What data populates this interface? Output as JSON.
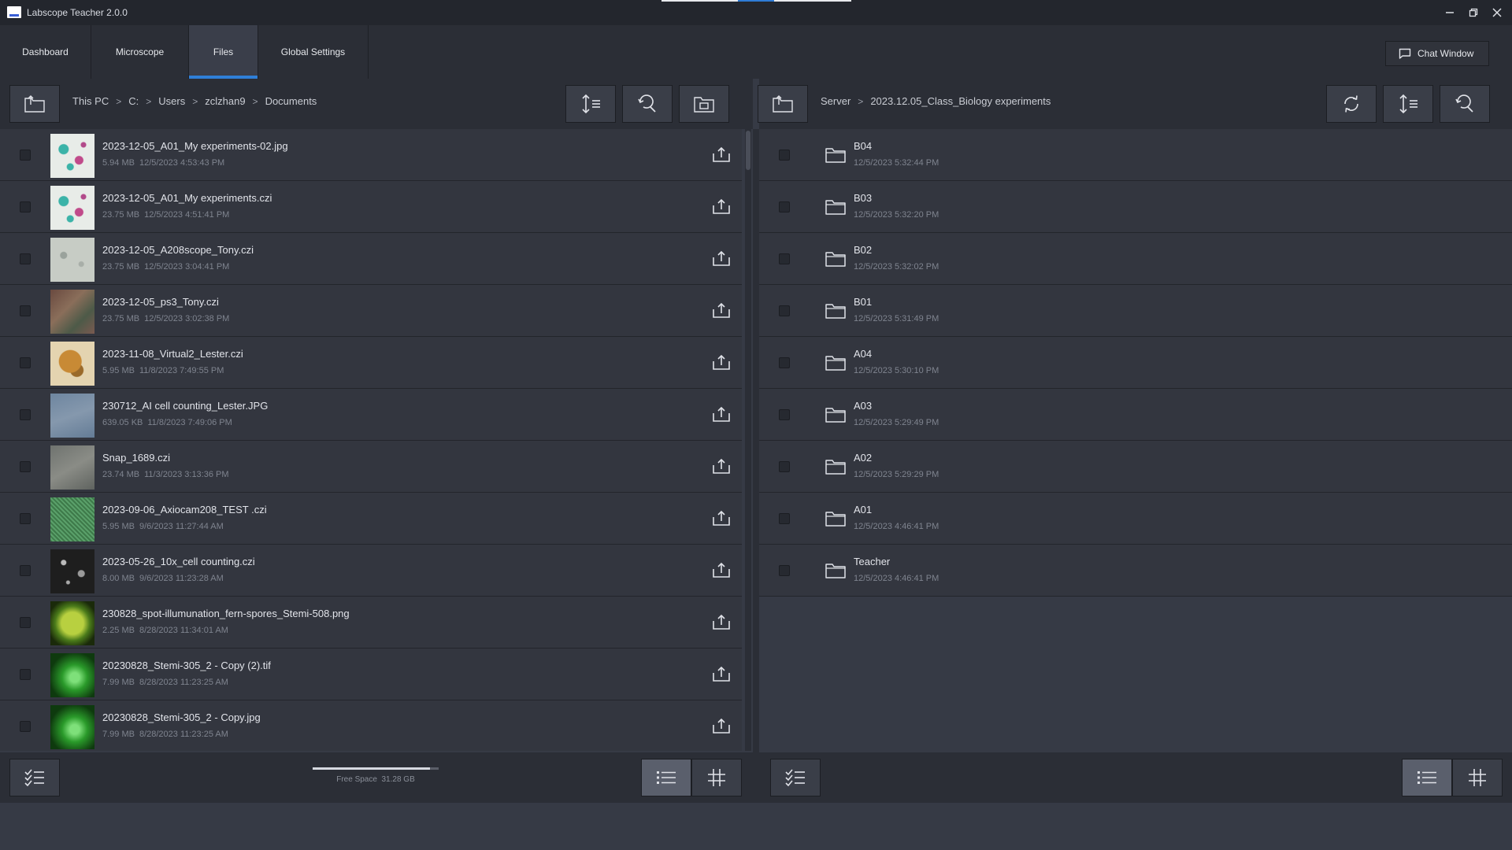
{
  "app": {
    "title": "Labscope Teacher 2.0.0"
  },
  "tabs": [
    {
      "label": "Dashboard",
      "active": false
    },
    {
      "label": "Microscope",
      "active": false
    },
    {
      "label": "Files",
      "active": true
    },
    {
      "label": "Global Settings",
      "active": false
    }
  ],
  "chat_button": {
    "label": "Chat Window"
  },
  "left_panel": {
    "breadcrumb": [
      "This PC",
      "C:",
      "Users",
      "zclzhan9",
      "Documents"
    ],
    "files": [
      {
        "name": "2023-12-05_A01_My experiments-02.jpg",
        "size": "5.94 MB",
        "date": "12/5/2023 4:53:43 PM",
        "thumb": "cells"
      },
      {
        "name": "2023-12-05_A01_My experiments.czi",
        "size": "23.75 MB",
        "date": "12/5/2023 4:51:41 PM",
        "thumb": "cells"
      },
      {
        "name": "2023-12-05_A208scope_Tony.czi",
        "size": "23.75 MB",
        "date": "12/5/2023 3:04:41 PM",
        "thumb": "grey-cells"
      },
      {
        "name": "2023-12-05_ps3_Tony.czi",
        "size": "23.75 MB",
        "date": "12/5/2023 3:02:38 PM",
        "thumb": "tissue"
      },
      {
        "name": "2023-11-08_Virtual2_Lester.czi",
        "size": "5.95 MB",
        "date": "11/8/2023 7:49:55 PM",
        "thumb": "insect"
      },
      {
        "name": "230712_AI cell counting_Lester.JPG",
        "size": "639.05 KB",
        "date": "11/8/2023 7:49:06 PM",
        "thumb": "blue-grey"
      },
      {
        "name": "Snap_1689.czi",
        "size": "23.74 MB",
        "date": "11/3/2023 3:13:36 PM",
        "thumb": "grey"
      },
      {
        "name": "2023-09-06_Axiocam208_TEST .czi",
        "size": "5.95 MB",
        "date": "9/6/2023 11:27:44 AM",
        "thumb": "green-texture"
      },
      {
        "name": "2023-05-26_10x_cell counting.czi",
        "size": "8.00 MB",
        "date": "9/6/2023 11:23:28 AM",
        "thumb": "dark-cells"
      },
      {
        "name": "230828_spot-illumunation_fern-spores_Stemi-508.png",
        "size": "2.25 MB",
        "date": "8/28/2023 11:34:01 AM",
        "thumb": "fern"
      },
      {
        "name": "20230828_Stemi-305_2 - Copy (2).tif",
        "size": "7.99 MB",
        "date": "8/28/2023 11:23:25 AM",
        "thumb": "green-plant"
      },
      {
        "name": "20230828_Stemi-305_2 - Copy.jpg",
        "size": "7.99 MB",
        "date": "8/28/2023 11:23:25 AM",
        "thumb": "green-plant"
      }
    ],
    "free_space": {
      "label": "Free Space",
      "value": "31.28 GB",
      "fill_fraction": 0.93
    }
  },
  "right_panel": {
    "breadcrumb": [
      "Server",
      "2023.12.05_Class_Biology experiments"
    ],
    "folders": [
      {
        "name": "B04",
        "date": "12/5/2023 5:32:44 PM"
      },
      {
        "name": "B03",
        "date": "12/5/2023 5:32:20 PM"
      },
      {
        "name": "B02",
        "date": "12/5/2023 5:32:02 PM"
      },
      {
        "name": "B01",
        "date": "12/5/2023 5:31:49 PM"
      },
      {
        "name": "A04",
        "date": "12/5/2023 5:30:10 PM"
      },
      {
        "name": "A03",
        "date": "12/5/2023 5:29:49 PM"
      },
      {
        "name": "A02",
        "date": "12/5/2023 5:29:29 PM"
      },
      {
        "name": "A01",
        "date": "12/5/2023 4:46:41 PM"
      },
      {
        "name": "Teacher",
        "date": "12/5/2023 4:46:41 PM"
      }
    ]
  },
  "colors": {
    "accent": "#2f7fd8",
    "background": "#363a45",
    "panel": "#2b2e36",
    "row": "#33363f"
  },
  "icons": {
    "folder_up": "folder-up-icon",
    "sort": "sort-icon",
    "search": "search-icon",
    "new_folder": "new-folder-icon",
    "refresh": "refresh-icon",
    "upload": "upload-icon",
    "folder": "folder-icon",
    "select_all": "select-all-icon",
    "list_view": "list-view-icon",
    "grid_view": "grid-view-icon",
    "chat": "chat-icon"
  }
}
